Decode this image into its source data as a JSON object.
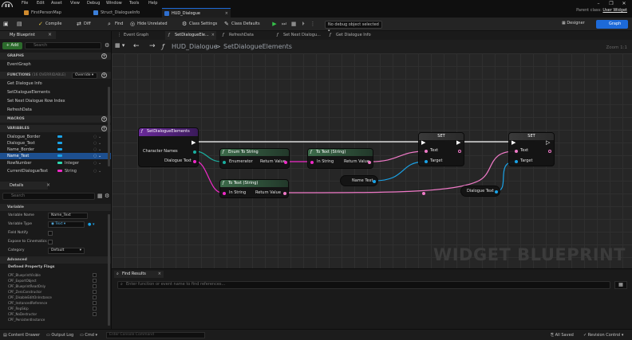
{
  "window": {
    "menu": [
      "File",
      "Edit",
      "Asset",
      "View",
      "Debug",
      "Window",
      "Tools",
      "Help"
    ],
    "tabs": [
      {
        "label": "FirstPersonMap",
        "active": false
      },
      {
        "label": "Struct_DialogueInfo",
        "active": false
      },
      {
        "label": "HUD_Dialogue",
        "active": true
      }
    ],
    "parent_class_label": "Parent class:",
    "parent_class_value": "User Widget",
    "controls": [
      "–",
      "❐",
      "✕"
    ]
  },
  "toolbar": {
    "compile": "Compile",
    "diff": "Diff",
    "find": "Find",
    "hide_unrelated": "Hide Unrelated",
    "class_settings": "Class Settings",
    "class_defaults": "Class Defaults",
    "debug_object": "No debug object selected",
    "designer": "Designer",
    "graph": "Graph"
  },
  "my_blueprint": {
    "title": "My Blueprint",
    "add": "+ Add",
    "search_placeholder": "Search",
    "sections": {
      "graphs": "GRAPHS",
      "functions": "FUNCTIONS",
      "functions_suffix": "(16 OVERRIDABLE)",
      "override": "Override",
      "macros": "MACROS",
      "variables": "VARIABLES"
    },
    "graphs": [
      "EventGraph"
    ],
    "functions": [
      "Get Dialogue Info",
      "SetDialogueElements",
      "Set Next Dialogue Row Index",
      "RefreshData"
    ],
    "variables": [
      {
        "name": "Dialogue_Border",
        "type": "",
        "color": "#1aa3e8",
        "selected": false
      },
      {
        "name": "Dialogue_Text",
        "type": "",
        "color": "#1aa3e8",
        "selected": false
      },
      {
        "name": "Name_Border",
        "type": "",
        "color": "#1aa3e8",
        "selected": false
      },
      {
        "name": "Name_Text",
        "type": "",
        "color": "#1aa3e8",
        "selected": true
      },
      {
        "name": "RowNumber",
        "type": "Integer",
        "color": "#2fd9b0",
        "selected": false
      },
      {
        "name": "CurrentDialogueText",
        "type": "String",
        "color": "#f02ac8",
        "selected": false
      }
    ]
  },
  "details": {
    "title": "Details",
    "search_placeholder": "Search",
    "variable_section": "Variable",
    "fields": [
      {
        "label": "Variable Name",
        "value": "Name_Text"
      },
      {
        "label": "Variable Type",
        "value": "Text"
      },
      {
        "label": "Field Notify",
        "value": ""
      },
      {
        "label": "Expose to Cinematics",
        "value": ""
      },
      {
        "label": "Category",
        "value": "Default"
      }
    ],
    "advanced_section": "Advanced",
    "flags_title": "Defined Property Flags",
    "flags": [
      "CPF_BlueprintVisible",
      "CPF_ExportObject",
      "CPF_BlueprintReadOnly",
      "CPF_ZeroConstructor",
      "CPF_DisableEditOnInstance",
      "CPF_InstancedReference",
      "CPF_RepSkip",
      "CPF_NoDestructor",
      "CPF_PersistentInstance"
    ]
  },
  "graph_tabs": [
    {
      "label": "Event Graph",
      "active": false
    },
    {
      "label": "SetDialogueEle...",
      "active": true
    },
    {
      "label": "RefreshData",
      "active": false
    },
    {
      "label": "Set Next Dialogu...",
      "active": false
    },
    {
      "label": "Get Dialogue Info",
      "active": false
    }
  ],
  "breadcrumb": {
    "root": "HUD_Dialogue",
    "separator": ">",
    "current": "SetDialogueElements"
  },
  "zoom": "Zoom 1:1",
  "watermark": "WIDGET BLUEPRINT",
  "nodes": {
    "entry": {
      "title": "SetDialogueElements",
      "pin_character_names": "Character Names",
      "pin_dialogue_text": "Dialogue Text"
    },
    "enum_to_string": {
      "title": "Enum To String",
      "pin_in": "Enumerator",
      "pin_out": "Return Value"
    },
    "to_text_1": {
      "title": "To Text (String)",
      "pin_in": "In String",
      "pin_out": "Return Value"
    },
    "to_text_2": {
      "title": "To Text (String)",
      "pin_in": "In String",
      "pin_out": "Return Value"
    },
    "set_1": {
      "title": "SET",
      "pin_text": "Text",
      "pin_target": "Target"
    },
    "set_2": {
      "title": "SET",
      "pin_text": "Text",
      "pin_target": "Target"
    },
    "name_text_getter": {
      "label": "Name Text"
    },
    "dialogue_text_getter": {
      "label": "Dialogue Text"
    }
  },
  "find_results": {
    "title": "Find Results",
    "placeholder": "Enter function or event name to find references..."
  },
  "statusbar": {
    "content_drawer": "Content Drawer",
    "output_log": "Output Log",
    "cmd": "Cmd",
    "cmd_placeholder": "Enter Console Command",
    "all_saved": "All Saved",
    "revision_control": "Revision Control"
  }
}
